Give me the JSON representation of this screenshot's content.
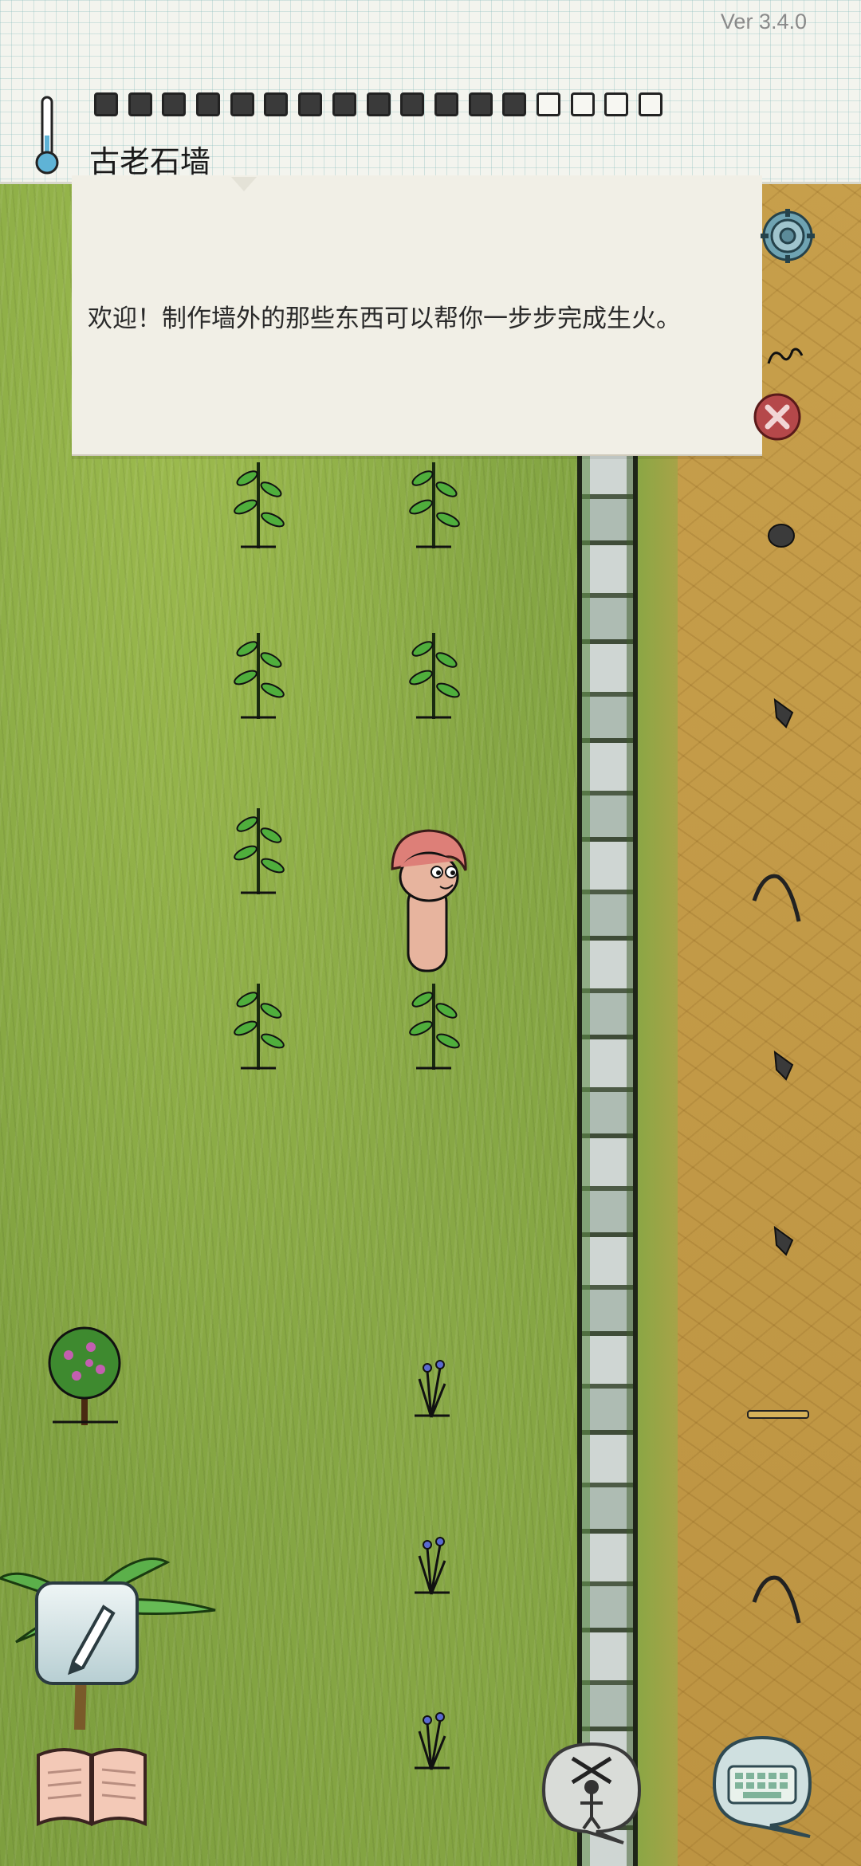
{
  "version_label": "Ver 3.4.0",
  "location": {
    "title": "古老石墙"
  },
  "food_meter": {
    "filled": 13,
    "total": 17
  },
  "message": {
    "text": "欢迎！制作墙外的那些东西可以帮你一步步完成生火。"
  },
  "icons": {
    "thermometer": "thermometer-icon",
    "settings": "gear-icon",
    "close_message": "close-icon",
    "pencil": "pencil-icon",
    "recipe_book": "book-icon",
    "emote": "puppet-icon",
    "keyboard": "keyboard-icon"
  },
  "colors": {
    "grass": "#86a844",
    "dirt": "#c8a04c",
    "note_paper": "#f1efe6",
    "close_button": "#b5484a",
    "gear": "#6fa3b2"
  }
}
